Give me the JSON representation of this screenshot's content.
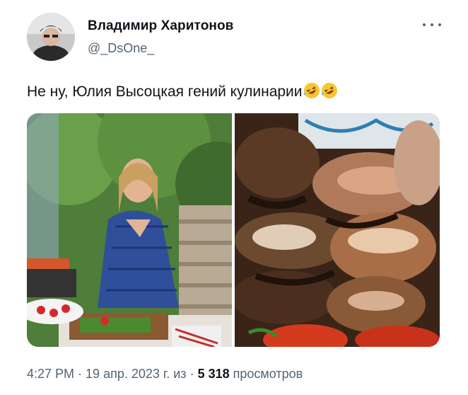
{
  "author": {
    "display_name": "Владимир Харитонов",
    "handle": "@_DsOne_"
  },
  "tweet": {
    "text": "Не ну, Юлия Высоцкая гений кулинарии",
    "emojis": [
      "rolling-on-floor-laughing",
      "rolling-on-floor-laughing"
    ]
  },
  "media": [
    {
      "name": "woman-cooking-outdoors-photo"
    },
    {
      "name": "burnt-bacon-wrapped-meat-photo"
    }
  ],
  "meta": {
    "time": "4:27 PM",
    "separator": " · ",
    "date": "19 апр. 2023 г. из",
    "separator2": " · ",
    "views_count": "5 318",
    "views_label": " просмотров"
  },
  "colors": {
    "text": "#0f1419",
    "secondary": "#536471"
  }
}
